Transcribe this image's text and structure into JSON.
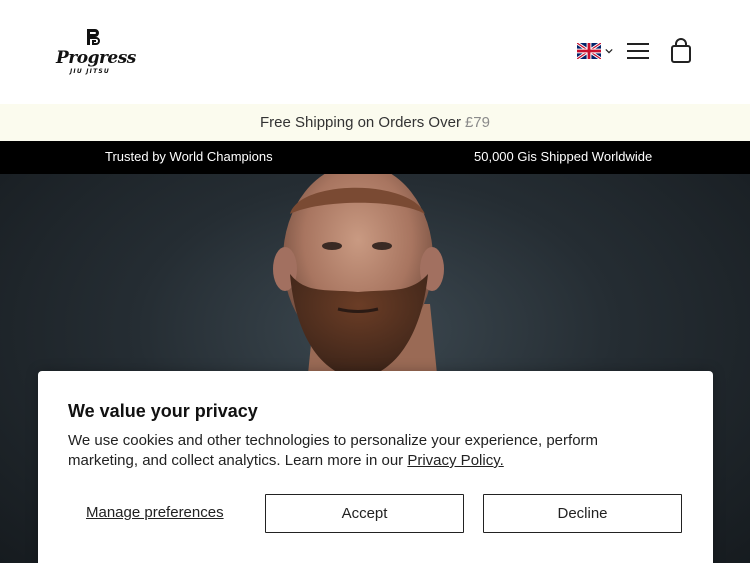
{
  "header": {
    "logo_text": "Progress",
    "logo_sub": "JIU JITSU",
    "flag_icon": "uk-flag-icon",
    "menu_icon": "hamburger-menu-icon",
    "cart_icon": "shopping-bag-icon"
  },
  "promo": {
    "text": "Free Shipping on Orders Over",
    "price": "£79",
    "bg_color": "#fbfbee"
  },
  "trust_bar": {
    "items": [
      "Trusted by World Champions",
      "50,000 Gis Shipped Worldwide"
    ],
    "bg_color": "#000000"
  },
  "cookie_banner": {
    "title": "We value your privacy",
    "body": "We use cookies and other technologies to personalize your experience, perform marketing, and collect analytics. Learn more in our",
    "link": "Privacy Policy.",
    "manage_label": "Manage preferences",
    "accept_label": "Accept",
    "decline_label": "Decline"
  }
}
